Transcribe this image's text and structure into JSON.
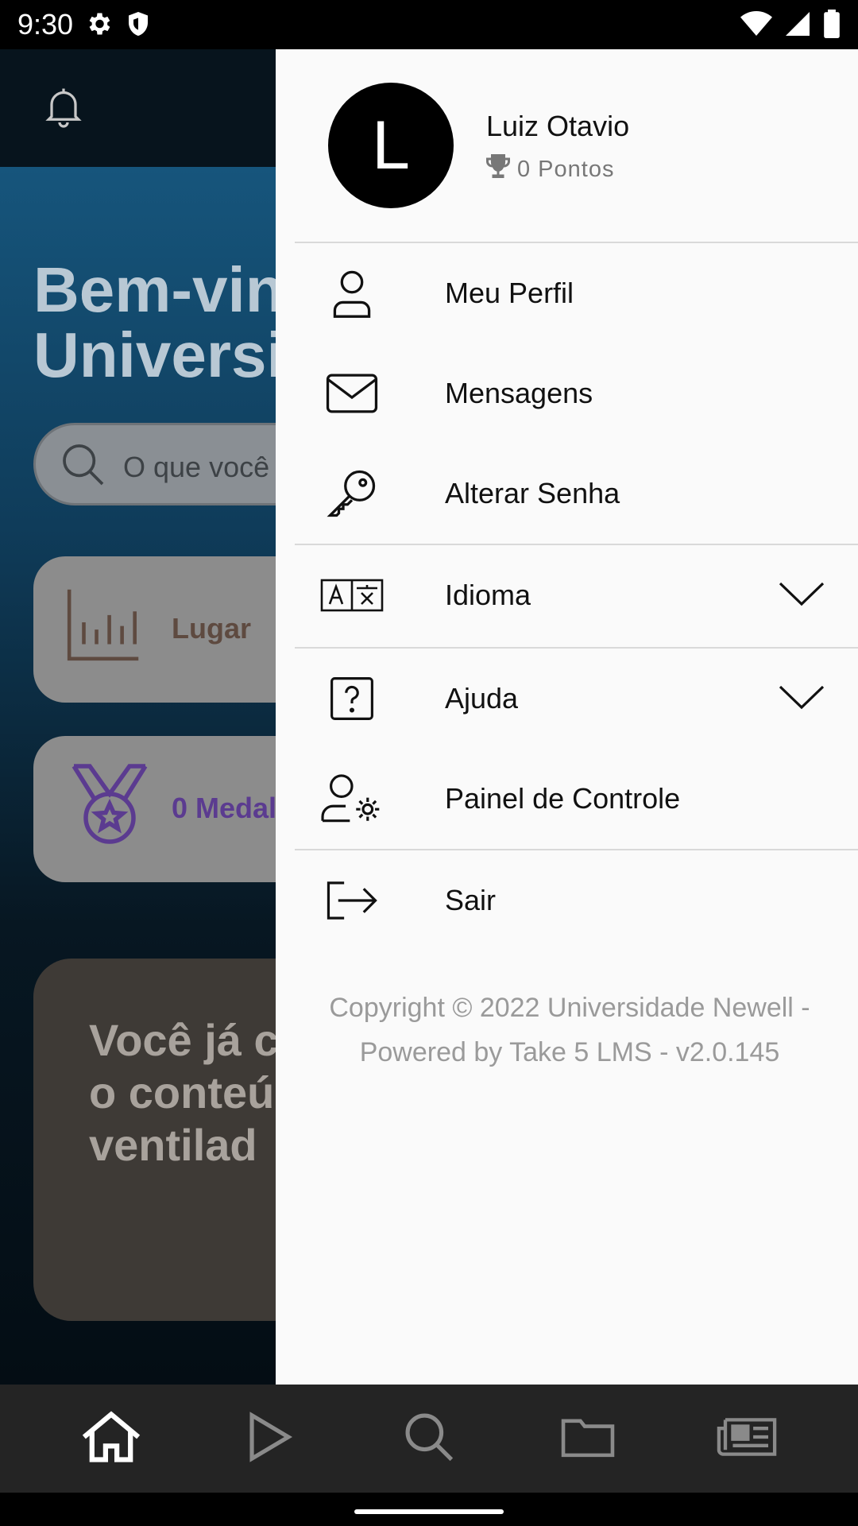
{
  "status_bar": {
    "time": "9:30",
    "left_icons": [
      "gear-icon",
      "shield-icon"
    ],
    "right_icons": [
      "wifi-icon",
      "signal-icon",
      "battery-icon"
    ]
  },
  "background": {
    "welcome_text": "Bem-vin\nUniversid",
    "search_placeholder": "O que você",
    "rank_card_label": "Lugar",
    "medal_card_label": "0 Medal",
    "banner_text": "Você já c\no conteú\nventilad"
  },
  "drawer": {
    "avatar_letter": "L",
    "user_name": "Luiz Otavio",
    "points": "0 Pontos",
    "menu": [
      {
        "label": "Meu Perfil",
        "icon": "user-icon"
      },
      {
        "label": "Mensagens",
        "icon": "envelope-icon"
      },
      {
        "label": "Alterar Senha",
        "icon": "key-icon"
      },
      {
        "label": "Idioma",
        "icon": "translate-icon",
        "expandable": true
      },
      {
        "label": "Ajuda",
        "icon": "help-icon",
        "expandable": true
      },
      {
        "label": "Painel de Controle",
        "icon": "user-settings-icon"
      },
      {
        "label": "Sair",
        "icon": "logout-icon"
      }
    ],
    "copyright": "Copyright © 2022 Universidade Newell - Powered by Take 5 LMS - v2.0.145"
  },
  "bottom_nav": {
    "items": [
      "home-icon",
      "play-icon",
      "search-icon",
      "folder-icon",
      "news-icon"
    ],
    "active": "home-icon"
  },
  "colors": {
    "drawer_bg": "#fafafa",
    "nav_bg": "#242424",
    "medal_purple": "#5b3b90"
  }
}
